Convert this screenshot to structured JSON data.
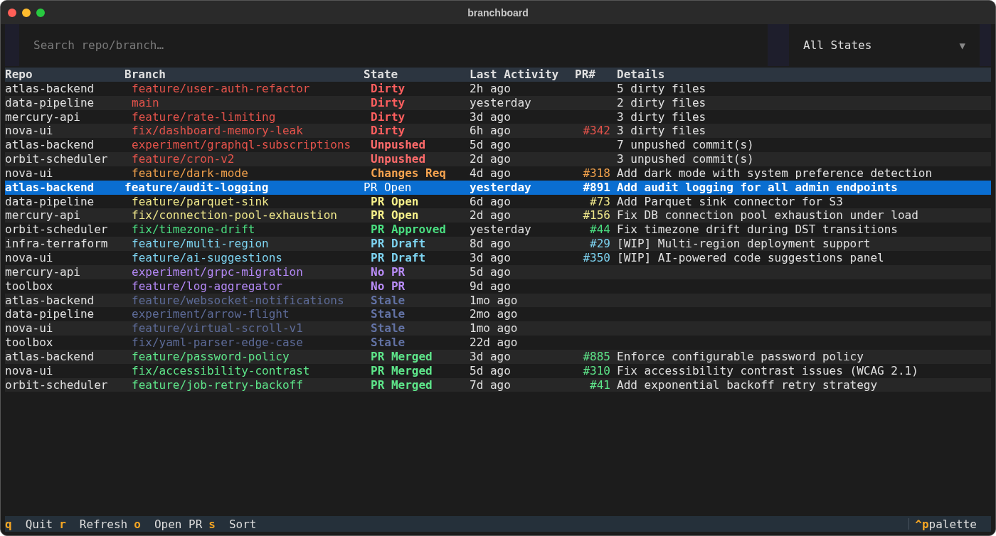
{
  "window": {
    "title": "branchboard"
  },
  "search": {
    "placeholder": "Search repo/branch…"
  },
  "state_filter": {
    "value": "All States",
    "arrow": "▼"
  },
  "table": {
    "columns": [
      "Repo",
      "Branch",
      "State",
      "Last Activity",
      "PR#",
      "Details"
    ],
    "rows": [
      {
        "repo": "atlas-backend",
        "branch": "feature/user-auth-refactor",
        "state": "Dirty",
        "kind": "dirty",
        "activity": "2h ago",
        "details": "5 dirty files",
        "selected": false
      },
      {
        "repo": "data-pipeline",
        "branch": "main",
        "state": "Dirty",
        "kind": "dirty",
        "activity": "yesterday",
        "details": "2 dirty files",
        "selected": false
      },
      {
        "repo": "mercury-api",
        "branch": "feature/rate-limiting",
        "state": "Dirty",
        "kind": "dirty",
        "activity": "3d ago",
        "details": "3 dirty files",
        "selected": false
      },
      {
        "repo": "nova-ui",
        "branch": "fix/dashboard-memory-leak",
        "state": "Dirty",
        "kind": "dirty",
        "activity": "6h ago",
        "pr": "#342",
        "details": "3 dirty files",
        "selected": false
      },
      {
        "repo": "atlas-backend",
        "branch": "experiment/graphql-subscriptions",
        "state": "Unpushed",
        "kind": "unpushed",
        "activity": "5d ago",
        "details": "7 unpushed commit(s)",
        "selected": false
      },
      {
        "repo": "orbit-scheduler",
        "branch": "feature/cron-v2",
        "state": "Unpushed",
        "kind": "unpushed",
        "activity": "2d ago",
        "details": "3 unpushed commit(s)",
        "selected": false
      },
      {
        "repo": "nova-ui",
        "branch": "feature/dark-mode",
        "state": "Changes Req",
        "kind": "changes",
        "activity": "4d ago",
        "pr": "#318",
        "details": "Add dark mode with system preference detection",
        "selected": false
      },
      {
        "repo": "atlas-backend",
        "branch": "feature/audit-logging",
        "state": "PR Open",
        "kind": "open",
        "activity": "yesterday",
        "pr": "#891",
        "details": "Add audit logging for all admin endpoints",
        "selected": true
      },
      {
        "repo": "data-pipeline",
        "branch": "feature/parquet-sink",
        "state": "PR Open",
        "kind": "open",
        "activity": "6d ago",
        "pr": "#73",
        "details": "Add Parquet sink connector for S3",
        "selected": false
      },
      {
        "repo": "mercury-api",
        "branch": "fix/connection-pool-exhaustion",
        "state": "PR Open",
        "kind": "open",
        "activity": "2d ago",
        "pr": "#156",
        "details": "Fix DB connection pool exhaustion under load",
        "selected": false
      },
      {
        "repo": "orbit-scheduler",
        "branch": "fix/timezone-drift",
        "state": "PR Approved",
        "kind": "approved",
        "activity": "yesterday",
        "pr": "#44",
        "details": "Fix timezone drift during DST transitions",
        "selected": false
      },
      {
        "repo": "infra-terraform",
        "branch": "feature/multi-region",
        "state": "PR Draft",
        "kind": "draft",
        "activity": "8d ago",
        "pr": "#29",
        "details": "[WIP] Multi-region deployment support",
        "selected": false
      },
      {
        "repo": "nova-ui",
        "branch": "feature/ai-suggestions",
        "state": "PR Draft",
        "kind": "draft",
        "activity": "3d ago",
        "pr": "#350",
        "details": "[WIP] AI-powered code suggestions panel",
        "selected": false
      },
      {
        "repo": "mercury-api",
        "branch": "experiment/grpc-migration",
        "state": "No PR",
        "kind": "nopr",
        "activity": "5d ago",
        "selected": false
      },
      {
        "repo": "toolbox",
        "branch": "feature/log-aggregator",
        "state": "No PR",
        "kind": "nopr",
        "activity": "9d ago",
        "selected": false
      },
      {
        "repo": "atlas-backend",
        "branch": "feature/websocket-notifications",
        "state": "Stale",
        "kind": "stale",
        "activity": "1mo ago",
        "selected": false
      },
      {
        "repo": "data-pipeline",
        "branch": "experiment/arrow-flight",
        "state": "Stale",
        "kind": "stale",
        "activity": "2mo ago",
        "selected": false
      },
      {
        "repo": "nova-ui",
        "branch": "feature/virtual-scroll-v1",
        "state": "Stale",
        "kind": "stale",
        "activity": "1mo ago",
        "selected": false
      },
      {
        "repo": "toolbox",
        "branch": "fix/yaml-parser-edge-case",
        "state": "Stale",
        "kind": "stale",
        "activity": "22d ago",
        "selected": false
      },
      {
        "repo": "atlas-backend",
        "branch": "feature/password-policy",
        "state": "PR Merged",
        "kind": "merged",
        "activity": "3d ago",
        "pr": "#885",
        "details": "Enforce configurable password policy",
        "selected": false
      },
      {
        "repo": "nova-ui",
        "branch": "fix/accessibility-contrast",
        "state": "PR Merged",
        "kind": "merged",
        "activity": "5d ago",
        "pr": "#310",
        "details": "Fix accessibility contrast issues (WCAG 2.1)",
        "selected": false
      },
      {
        "repo": "orbit-scheduler",
        "branch": "feature/job-retry-backoff",
        "state": "PR Merged",
        "kind": "merged",
        "activity": "7d ago",
        "pr": "#41",
        "details": "Add exponential backoff retry strategy",
        "selected": false
      }
    ]
  },
  "footer": {
    "bindings": [
      {
        "key": "q",
        "label": "Quit"
      },
      {
        "key": "r",
        "label": "Refresh"
      },
      {
        "key": "o",
        "label": "Open PR"
      },
      {
        "key": "s",
        "label": "Sort"
      }
    ],
    "palette": {
      "key": "^p",
      "label": "palette"
    }
  }
}
